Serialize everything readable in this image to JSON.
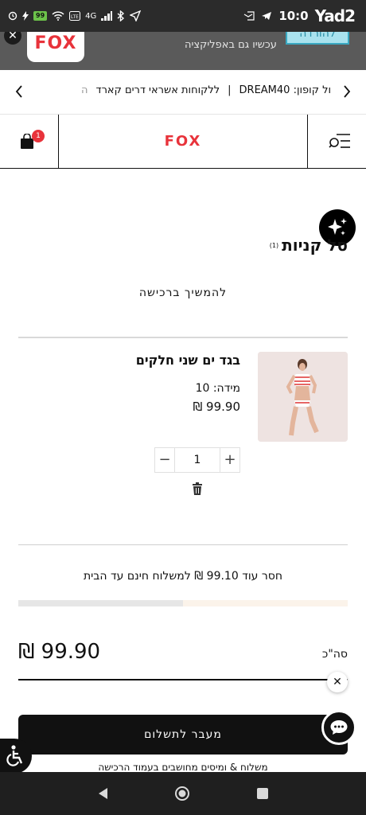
{
  "status_bar": {
    "battery": "99",
    "network": "4G",
    "time": "10:0",
    "app_badge": "Yad2"
  },
  "app_banner": {
    "close_label": "✕",
    "logo_text": "FOX",
    "message": "עכשיו גם באפליקציה",
    "cta_label": "להורדה"
  },
  "promo": {
    "coupon_text": "ול קופון: DREAM40",
    "customers_text": "ללקוחות אשראי דרים קארד",
    "tail": "ה",
    "prev_icon": "chevron-left-icon",
    "next_icon": "chevron-right-icon"
  },
  "header": {
    "logo": "FOX",
    "cart_count": "1",
    "cart_icon": "shopping-bag-icon",
    "menu_icon": "search-menu-icon"
  },
  "cart": {
    "title": "סל קניות",
    "count": "(1)",
    "continue_label": "להמשיך ברכישה"
  },
  "item": {
    "name": "בגד ים שני חלקים",
    "size": "מידה: 10",
    "price": "99.90 ₪",
    "quantity": "1",
    "minus": "−",
    "plus": "+"
  },
  "shipping": {
    "message": "חסר עוד 99.10 ₪ למשלוח חינם עד הבית",
    "progress_fraction": 0.5
  },
  "totals": {
    "label": "סה\"כ",
    "value": "99.90 ₪"
  },
  "checkout": {
    "label": "מעבר לתשלום",
    "note": "משלוח & ומיסים מחושבים בעמוד הרכישה"
  },
  "floating": {
    "close_label": "✕"
  },
  "colors": {
    "brand_red": "#e8333b",
    "banner_cta": "#a9e2ee",
    "dark": "#111111"
  }
}
